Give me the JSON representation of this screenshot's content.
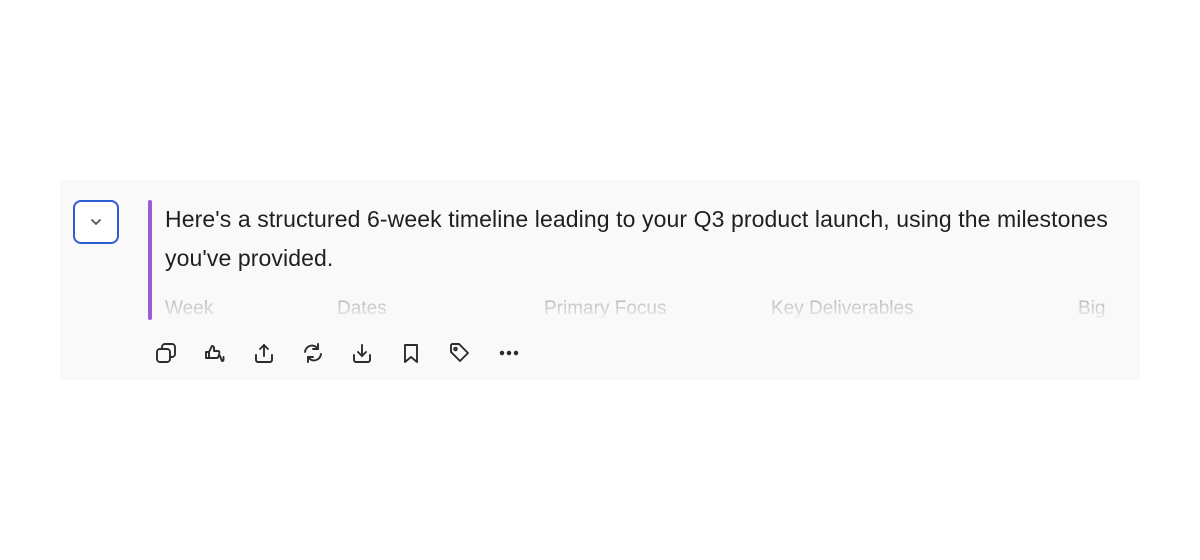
{
  "message": {
    "text": "Here's a structured 6-week timeline leading to your Q3 product launch, using the milestones you've provided."
  },
  "table": {
    "columns": [
      "Week",
      "Dates",
      "Primary Focus",
      "Key Deliverables",
      "Big"
    ]
  },
  "colors": {
    "accent_bar": "#9a5bd6",
    "collapse_border": "#2f5bd3",
    "card_background": "#f9f9f9"
  },
  "actions": [
    {
      "icon": "copy-icon"
    },
    {
      "icon": "thumbs-up-down-icon"
    },
    {
      "icon": "share-icon"
    },
    {
      "icon": "regenerate-icon"
    },
    {
      "icon": "download-icon"
    },
    {
      "icon": "bookmark-icon"
    },
    {
      "icon": "tag-icon"
    },
    {
      "icon": "more-icon"
    }
  ]
}
